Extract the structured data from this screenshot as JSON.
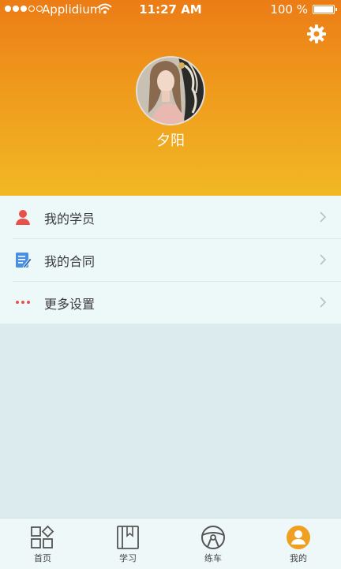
{
  "status_bar": {
    "carrier": "Applidium",
    "time": "11:27 AM",
    "battery": "100 %"
  },
  "profile": {
    "name": "夕阳"
  },
  "menu": {
    "items": [
      {
        "label": "我的学员",
        "icon": "person-icon",
        "color": "#e8504a"
      },
      {
        "label": "我的合同",
        "icon": "edit-document-icon",
        "color": "#4a8fe0"
      },
      {
        "label": "更多设置",
        "icon": "more-dots-icon",
        "color": "#e8504a"
      }
    ]
  },
  "tabbar": {
    "tabs": [
      {
        "label": "首页",
        "icon": "grid-icon"
      },
      {
        "label": "学习",
        "icon": "book-icon"
      },
      {
        "label": "练车",
        "icon": "steering-wheel-icon"
      },
      {
        "label": "我的",
        "icon": "profile-icon",
        "active": true
      }
    ]
  },
  "colors": {
    "header_top": "#ec7c16",
    "header_bottom": "#f1b824",
    "accent": "#f0a020",
    "background": "#dcecee"
  }
}
